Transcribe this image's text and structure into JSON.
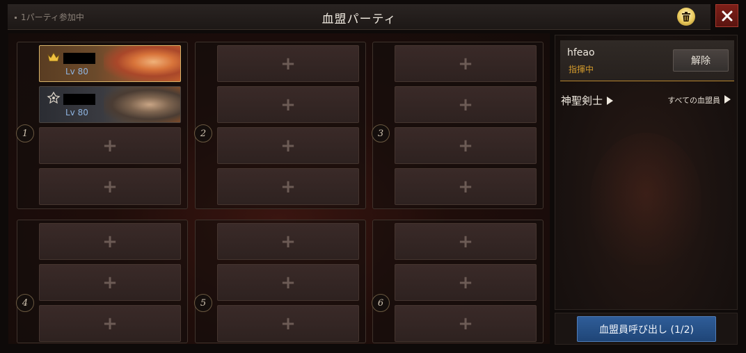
{
  "header": {
    "party_count": "1パーティ参加中",
    "title": "血盟パーティ"
  },
  "parties": [
    {
      "number": "1",
      "members": [
        {
          "role": "leader",
          "level": "Lv 80",
          "role_icon": "crown-icon"
        },
        {
          "role": "member",
          "level": "Lv 80",
          "role_icon": "knight-emblem-icon"
        }
      ],
      "empty_slots": 2
    },
    {
      "number": "2",
      "members": [],
      "empty_slots": 4
    },
    {
      "number": "3",
      "members": [],
      "empty_slots": 4
    },
    {
      "number": "4",
      "members": [],
      "empty_slots": 3
    },
    {
      "number": "5",
      "members": [],
      "empty_slots": 3
    },
    {
      "number": "6",
      "members": [],
      "empty_slots": 3
    }
  ],
  "empty_slot_symbol": "+",
  "right_panel": {
    "leader_name": "hfeao",
    "leader_status": "指揮中",
    "release_label": "解除",
    "class_filter": "神聖剣士",
    "all_members_label": "すべての血盟員"
  },
  "summon_label": "血盟員呼び出し (1/2)",
  "colors": {
    "accent_gold": "#d29a2c",
    "level_blue": "#8fb4e0",
    "summon_blue": "#2f5d98",
    "close_red": "#7d1f18"
  }
}
